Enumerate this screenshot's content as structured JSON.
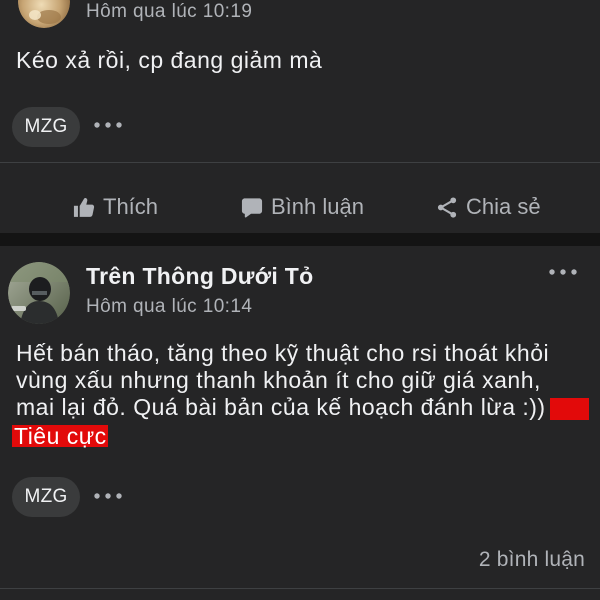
{
  "theme": {
    "card_background": "#252526",
    "feed_separator": "#141414",
    "divider": "#3e4042",
    "text_primary": "#f0f1f3",
    "text_secondary": "#b0b3b8",
    "pill_background": "#3a3b3c",
    "negative_label": "#e20a0a"
  },
  "posts": [
    {
      "timestamp": "Hôm qua lúc 10:19",
      "text": "Kéo xả rồi, cp đang giảm mà",
      "comment_pill": {
        "label": "MZG"
      },
      "actions": [
        {
          "icon": "thumbs-up-icon",
          "label": "Thích"
        },
        {
          "icon": "comment-icon",
          "label": "Bình luận"
        },
        {
          "icon": "share-icon",
          "label": "Chia sẻ"
        }
      ]
    },
    {
      "author": "Trên Thông Dưới Tỏ",
      "timestamp": "Hôm qua lúc 10:14",
      "text_lines": [
        "Hết bán tháo, tăng theo kỹ thuật cho rsi thoát khỏi",
        "vùng xấu nhưng thanh khoản ít cho giữ giá xanh,",
        "mai lại đỏ. Quá bài bản của kế hoạch đánh lừa :))"
      ],
      "sentiment_label": "Tiêu cực",
      "comment_pill": {
        "label": "MZG"
      },
      "comment_count": "2 bình luận"
    }
  ]
}
